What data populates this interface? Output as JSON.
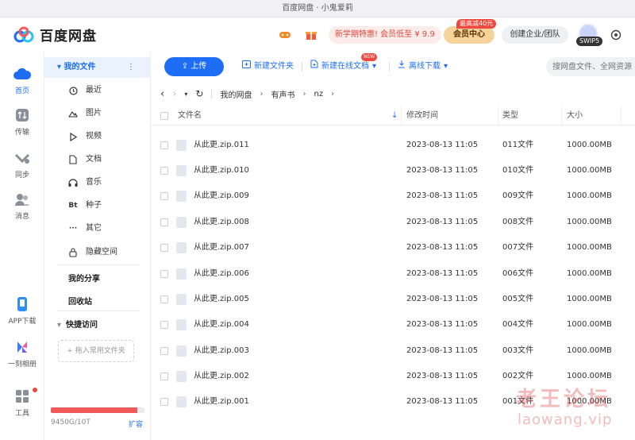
{
  "window": {
    "title": "百度网盘 · 小鬼爱莉"
  },
  "header": {
    "logo_text": "百度网盘",
    "promo": "新学期特惠! 会员低至 ¥ 9.9",
    "vip_tag": "最高减40元",
    "vip_center": "会员中心",
    "business": "创建企业/团队",
    "swip": "SWIP5"
  },
  "rail": {
    "home": "首页",
    "transfer": "传输",
    "sync": "同步",
    "messages": "消息",
    "app_download": "APP下载",
    "album": "一刻相册",
    "tools": "工具"
  },
  "sidebar": {
    "my_files": "我的文件",
    "items": [
      {
        "label": "最近",
        "icon": "clock-icon"
      },
      {
        "label": "图片",
        "icon": "image-icon"
      },
      {
        "label": "视频",
        "icon": "play-icon"
      },
      {
        "label": "文档",
        "icon": "document-icon"
      },
      {
        "label": "音乐",
        "icon": "headphones-icon"
      },
      {
        "label": "种子",
        "icon": "bt-icon",
        "glyph": "Bt"
      },
      {
        "label": "其它",
        "icon": "more-icon",
        "glyph": "···"
      },
      {
        "label": "隐藏空间",
        "icon": "lock-icon"
      }
    ],
    "my_share": "我的分享",
    "recycle": "回收站",
    "quick_access": "快捷访问",
    "add_folder": "+ 拖入常用文件夹",
    "quota_text": "9450G/10T",
    "quota_fraction": 0.9229,
    "expand": "扩容"
  },
  "toolbar": {
    "upload": "上传",
    "new_folder": "新建文件夹",
    "new_doc": "新建在线文档",
    "new_badge": "NEW",
    "offline": "离线下载",
    "search_placeholder": "搜网盘文件、全网资源"
  },
  "breadcrumb": {
    "root": "我的网盘",
    "level1": "有声书",
    "level2": "nz"
  },
  "table": {
    "headers": {
      "name": "文件名",
      "modified": "修改时间",
      "type": "类型",
      "size": "大小"
    },
    "rows": [
      {
        "name": "从此更.zip.011",
        "modified": "2023-08-13 11:05",
        "type": "011文件",
        "size": "1000.00MB"
      },
      {
        "name": "从此更.zip.010",
        "modified": "2023-08-13 11:05",
        "type": "010文件",
        "size": "1000.00MB"
      },
      {
        "name": "从此更.zip.009",
        "modified": "2023-08-13 11:05",
        "type": "009文件",
        "size": "1000.00MB"
      },
      {
        "name": "从此更.zip.008",
        "modified": "2023-08-13 11:05",
        "type": "008文件",
        "size": "1000.00MB"
      },
      {
        "name": "从此更.zip.007",
        "modified": "2023-08-13 11:05",
        "type": "007文件",
        "size": "1000.00MB"
      },
      {
        "name": "从此更.zip.006",
        "modified": "2023-08-13 11:05",
        "type": "006文件",
        "size": "1000.00MB"
      },
      {
        "name": "从此更.zip.005",
        "modified": "2023-08-13 11:05",
        "type": "005文件",
        "size": "1000.00MB"
      },
      {
        "name": "从此更.zip.004",
        "modified": "2023-08-13 11:05",
        "type": "004文件",
        "size": "1000.00MB"
      },
      {
        "name": "从此更.zip.003",
        "modified": "2023-08-13 11:05",
        "type": "003文件",
        "size": "1000.00MB"
      },
      {
        "name": "从此更.zip.002",
        "modified": "2023-08-13 11:05",
        "type": "002文件",
        "size": "1000.00MB"
      },
      {
        "name": "从此更.zip.001",
        "modified": "2023-08-13 11:05",
        "type": "001文件",
        "size": "1000.00MB"
      }
    ]
  },
  "watermark": {
    "line1": "老王论坛",
    "line2": "laowang.vip"
  },
  "colors": {
    "accent": "#1e6ef5",
    "promo": "#e0483e",
    "vip": "#f5d39a",
    "quota": "#f05a5a"
  }
}
